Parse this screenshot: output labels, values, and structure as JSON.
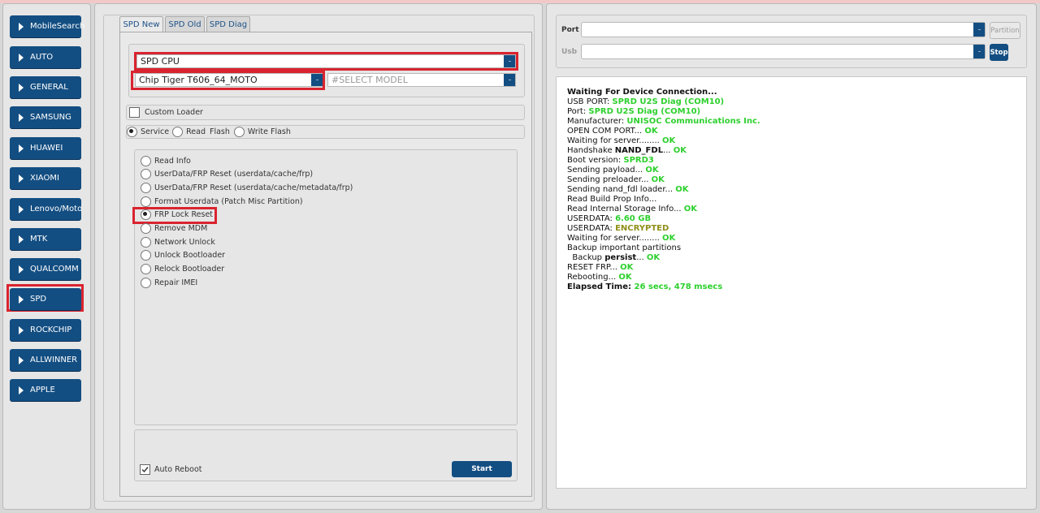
{
  "sidebar": {
    "items": [
      {
        "label": "MobileSearch"
      },
      {
        "label": "AUTO"
      },
      {
        "label": "GENERAL"
      },
      {
        "label": "SAMSUNG"
      },
      {
        "label": "HUAWEI"
      },
      {
        "label": "XIAOMI"
      },
      {
        "label": "Lenovo/Moto"
      },
      {
        "label": "MTK"
      },
      {
        "label": "QUALCOMM"
      },
      {
        "label": "SPD"
      },
      {
        "label": "ROCKCHIP"
      },
      {
        "label": "ALLWINNER"
      },
      {
        "label": "APPLE"
      }
    ],
    "selected": "SPD"
  },
  "tabs": [
    {
      "label": "SPD New"
    },
    {
      "label": "SPD Old"
    },
    {
      "label": "SPD Diag"
    }
  ],
  "cpu_select": {
    "value": "SPD CPU"
  },
  "chip_select": {
    "value": "Chip Tiger T606_64_MOTO"
  },
  "model_select": {
    "placeholder": "#SELECT MODEL"
  },
  "custom_loader": {
    "label": "Custom Loader",
    "checked": false
  },
  "modes": {
    "service": "Service",
    "read_flash_a": "Read",
    "read_flash_b": "Flash",
    "write_flash": "Write Flash",
    "selected": "Service"
  },
  "operations": [
    {
      "label": "Read Info"
    },
    {
      "label": "UserData/FRP Reset (userdata/cache/frp)"
    },
    {
      "label": "UserData/FRP Reset (userdata/cache/metadata/frp)"
    },
    {
      "label": "Format Userdata (Patch Misc Partition)"
    },
    {
      "label": "FRP Lock Reset"
    },
    {
      "label": "Remove MDM"
    },
    {
      "label": "Network Unlock"
    },
    {
      "label": "Unlock Bootloader"
    },
    {
      "label": "Relock Bootloader"
    },
    {
      "label": "Repair IMEI"
    }
  ],
  "selected_operation": "FRP Lock Reset",
  "auto_reboot": {
    "label": "Auto Reboot",
    "checked": true
  },
  "start_button": {
    "label": "Start"
  },
  "port": {
    "label": "Port",
    "value": ""
  },
  "usb": {
    "label": "Usb",
    "value": ""
  },
  "partition_button": {
    "label": "Partition"
  },
  "stop_button": {
    "label": "Stop"
  },
  "log": {
    "l1": "Waiting For Device Connection...",
    "l2a": "USB PORT: ",
    "l2b": "SPRD U2S Diag (COM10)",
    "l3a": "Port: ",
    "l3b": "SPRD U2S Diag (COM10)",
    "l4a": "Manufacturer: ",
    "l4b": "UNISOC Communications Inc.",
    "l5a": "OPEN COM PORT... ",
    "l5b": "OK",
    "l6a": "Waiting for server........ ",
    "l6b": "OK",
    "l7a": "Handshake ",
    "l7b": "NAND_FDL",
    "l7c": "... ",
    "l7d": "OK",
    "l8a": "Boot version: ",
    "l8b": "SPRD3",
    "l9a": "Sending payload... ",
    "l9b": "OK",
    "l10a": "Sending preloader... ",
    "l10b": "OK",
    "l11a": "Sending nand_fdl loader... ",
    "l11b": "OK",
    "l12": "Read Build Prop Info...",
    "l13a": "Read Internal Storage Info... ",
    "l13b": "OK",
    "l14a": "USERDATA: ",
    "l14b": "6.60 GB",
    "l15a": "USERDATA: ",
    "l15b": "ENCRYPTED",
    "l16a": "Waiting for server........ ",
    "l16b": "OK",
    "l17": "Backup important partitions",
    "l18a": "  Backup ",
    "l18b": "persist",
    "l18c": "... ",
    "l18d": "OK",
    "l19a": "RESET FRP... ",
    "l19b": "OK",
    "l20a": "Rebooting... ",
    "l20b": "OK",
    "l21a": "Elapsed Time: ",
    "l21b": "26 secs, 478 msecs"
  }
}
